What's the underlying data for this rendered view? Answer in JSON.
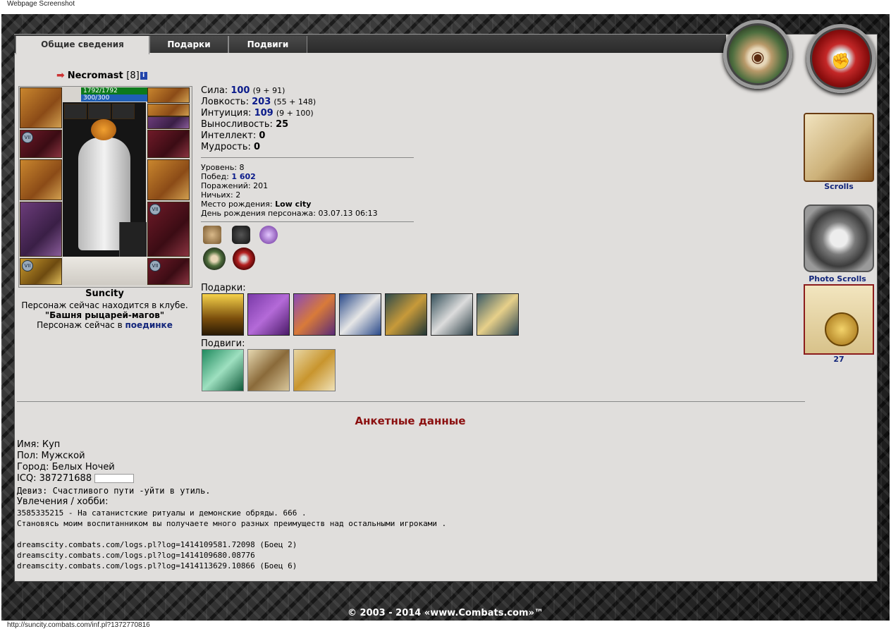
{
  "caption": "Webpage Screenshot",
  "status_url": "http://suncity.combats.com/inf.pl?1372770816",
  "tabs": [
    {
      "label": "Общие сведения",
      "active": true
    },
    {
      "label": "Подарки",
      "active": false
    },
    {
      "label": "Подвиги",
      "active": false
    }
  ],
  "character": {
    "name": "Necromast",
    "level": "[8]",
    "info_icon": "i",
    "hp": "1792/1792",
    "mp": "300/300",
    "city": "Suncity",
    "club_line": "Персонаж сейчас находится в клубе.",
    "location": "\"Башня рыцарей-магов\"",
    "state_prefix": "Персонаж сейчас в",
    "state_link": "поединке",
    "slot_badge": "VII"
  },
  "stats": {
    "strength": {
      "label": "Сила:",
      "value": "100",
      "detail": "(9 + 91)"
    },
    "agility": {
      "label": "Ловкость:",
      "value": "203",
      "detail": "(55 + 148)"
    },
    "intuition": {
      "label": "Интуиция:",
      "value": "109",
      "detail": "(9 + 100)"
    },
    "endurance": {
      "label": "Выносливость:",
      "value": "25"
    },
    "intellect": {
      "label": "Интеллект:",
      "value": "0"
    },
    "wisdom": {
      "label": "Мудрость:",
      "value": "0"
    }
  },
  "record": {
    "level": {
      "label": "Уровень:",
      "value": "8"
    },
    "wins": {
      "label": "Побед:",
      "value": "1 602"
    },
    "losses": {
      "label": "Поражений:",
      "value": "201"
    },
    "draws": {
      "label": "Ничьих:",
      "value": "2"
    },
    "birthplace": {
      "label": "Место рождения:",
      "value": "Low city"
    },
    "birthday": {
      "label": "День рождения персонажа:",
      "value": "03.07.13 06:13"
    }
  },
  "gifts_label": "Подарки:",
  "feats_label": "Подвиги:",
  "anketa": {
    "title": "Анкетные данные",
    "name": "Имя: Куп",
    "gender": "Пол: Мужской",
    "city": "Город: Белых Ночей",
    "icq": "ICQ: 387271688",
    "motto": "Девиз: Счастливого пути -уйти в утиль.",
    "hobby_label": "Увлечения / хобби:",
    "hobby_lines": "3585335215 - На сатанистские ритуалы и демонские обряды. 666 .\nСтановясь моим воспитанником вы получаете много разных преимуществ над остальными игроками .",
    "logs": "dreamscity.combats.com/logs.pl?log=1414109581.72098 (Боец 2)\ndreamscity.combats.com/logs.pl?log=1414109680.08776\ndreamscity.combats.com/logs.pl?log=1414113629.10866 (Боец 6)"
  },
  "sidebar": {
    "scrolls_label": "Scrolls",
    "photo_label": "Photo Scrolls",
    "count_label": "27"
  },
  "footer": "© 2003 - 2014 «www.Combats.com»™",
  "icons": [
    "pointer-arrow-icon",
    "info-icon",
    "bag-icon",
    "beetle-icon",
    "orb-icon",
    "rune-medal-icon",
    "red-medal-icon",
    "cake-gift-icon",
    "staff-gift-icon",
    "torch-gift-icon",
    "potion-gift-icon",
    "swords-gift-icon",
    "skull-goblet-gift-icon",
    "shield-gift-icon",
    "helmet-feat-icon",
    "warrior-feat-icon",
    "scroll-feat-icon",
    "book-quill-icon",
    "camera-icon",
    "medal-scroll-icon"
  ]
}
